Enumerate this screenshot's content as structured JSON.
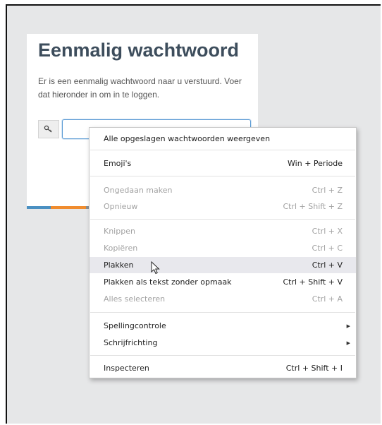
{
  "card": {
    "title": "Eenmalig wachtwoord",
    "description": "Er is een eenmalig wachtwoord naar u verstuurd. Voer dat hieronder in om in te loggen.",
    "input_value": "",
    "key_icon": "key-icon"
  },
  "context_menu": {
    "items": [
      {
        "label": "Alle opgeslagen wachtwoorden weergeven",
        "shortcut": "",
        "enabled": true
      },
      {
        "label": "Emoji's",
        "shortcut": "Win + Periode",
        "enabled": true
      },
      {
        "label": "Ongedaan maken",
        "shortcut": "Ctrl + Z",
        "enabled": false
      },
      {
        "label": "Opnieuw",
        "shortcut": "Ctrl + Shift + Z",
        "enabled": false
      },
      {
        "label": "Knippen",
        "shortcut": "Ctrl + X",
        "enabled": false
      },
      {
        "label": "Kopiëren",
        "shortcut": "Ctrl + C",
        "enabled": false
      },
      {
        "label": "Plakken",
        "shortcut": "Ctrl + V",
        "enabled": true,
        "hovered": true
      },
      {
        "label": "Plakken als tekst zonder opmaak",
        "shortcut": "Ctrl + Shift + V",
        "enabled": true
      },
      {
        "label": "Alles selecteren",
        "shortcut": "Ctrl + A",
        "enabled": false
      },
      {
        "label": "Spellingcontrole",
        "shortcut": "",
        "enabled": true,
        "submenu": true
      },
      {
        "label": "Schrijfrichting",
        "shortcut": "",
        "enabled": true,
        "submenu": true
      },
      {
        "label": "Inspecteren",
        "shortcut": "Ctrl + Shift + I",
        "enabled": true
      }
    ]
  },
  "colors": {
    "title": "#3d4d5c",
    "input_focus_border": "#5b9bd5",
    "stripe_blue": "#4a90c2",
    "stripe_orange": "#f08c2e",
    "stripe_gray": "#8a8f94",
    "hover_bg": "#e8e8ed"
  }
}
